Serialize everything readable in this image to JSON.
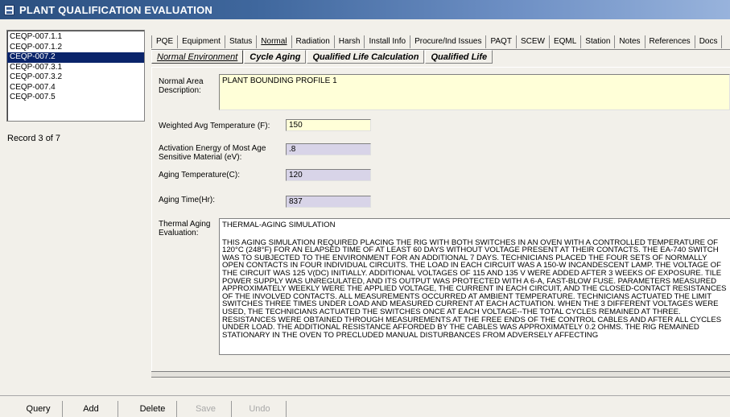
{
  "window": {
    "title": "PLANT QUALIFICATION EVALUATION"
  },
  "records": {
    "items": [
      "CEQP-007.1.1",
      "CEQP-007.1.2",
      "CEQP-007.2",
      "CEQP-007.3.1",
      "CEQP-007.3.2",
      "CEQP-007.4",
      "CEQP-007.5"
    ],
    "selected_index": 2,
    "count_text": "Record 3 of 7"
  },
  "tabs": {
    "items": [
      "PQE",
      "Equipment",
      "Status",
      "Normal",
      "Radiation",
      "Harsh",
      "Install Info",
      "Procure/Ind Issues",
      "PAQT",
      "SCEW",
      "EQML",
      "Station",
      "Notes",
      "References",
      "Docs"
    ],
    "active": "Normal"
  },
  "subtabs": {
    "items": [
      "Normal Environment",
      "Cycle Aging",
      "Qualified Life Calculation",
      "Qualified Life"
    ],
    "active": "Normal Environment"
  },
  "form": {
    "normal_area_label": "Normal Area Description:",
    "normal_area_value": "PLANT BOUNDING PROFILE 1",
    "weighted_avg_label": "Weighted Avg Temperature (F):",
    "weighted_avg_value": "150",
    "activation_energy_label": "Activation Energy of Most Age Sensitive Material (eV):",
    "activation_energy_value": ".8",
    "aging_temp_label": "Aging Temperature(C):",
    "aging_temp_value": "120",
    "aging_time_label": "Aging Time(Hr):",
    "aging_time_value": "837",
    "thermal_label": "Thermal Aging Evaluation:",
    "thermal_title": "THERMAL-AGING SIMULATION",
    "thermal_body": "THIS AGING SIMULATION REQUIRED PLACING THE RIG WITH BOTH SWITCHES IN AN OVEN WITH A CONTROLLED TEMPERATURE OF 120°C (248°F) FOR AN ELAPSED TIME OF AT LEAST 60 DAYS WITHOUT VOLTAGE PRESENT AT THEIR CONTACTS. THE EA-740 SWITCH WAS TO SUBJECTED TO THE ENVIRONMENT FOR AN ADDITIONAL 7 DAYS. TECHNICIANS PLACED THE FOUR SETS OF NORMALLY OPEN CONTACTS IN FOUR INDIVIDUAL CIRCUITS. THE LOAD IN EACH CIRCUIT WAS A 150-W INCANDESCENT LAMP. THE VOLTAGE OF THE CIRCUIT WAS 125 V(DC) INITIALLY. ADDITIONAL VOLTAGES OF 115 AND 135 V WERE ADDED AFTER 3 WEEKS OF EXPOSURE. TILE POWER SUPPLY WAS UNREGULATED, AND ITS OUTPUT WAS PROTECTED WITH A 6-A, FAST-BLOW FUSE. PARAMETERS MEASURED APPROXIMATELY WEEKLY WERE THE APPLIED VOLTAGE, THE CURRENT IN EACH CIRCUIT, AND THE CLOSED-CONTACT RESISTANCES OF THE INVOLVED CONTACTS. ALL MEASUREMENTS OCCURRED AT AMBIENT TEMPERATURE. TECHNICIANS ACTUATED THE LIMIT SWITCHES THREE TIMES UNDER LOAD AND MEASURED CURRENT AT EACH ACTUATION. WHEN THE 3 DIFFERENT VOLTAGES WERE USED, THE TECHNICIANS ACTUATED THE SWITCHES ONCE AT EACH VOLTAGE--THE TOTAL CYCLES REMAINED AT THREE. RESISTANCES WERE OBTAINED THROUGH MEASUREMENTS AT THE FREE ENDS OF THE CONTROL CABLES AND AFTER ALL CYCLES UNDER LOAD. THE ADDITIONAL RESISTANCE AFFORDED BY THE CABLES WAS APPROXIMATELY 0.2 OHMS. THE RIG REMAINED STATIONARY IN THE OVEN TO PRECLUDED MANUAL DISTURBANCES FROM ADVERSELY AFFECTING"
  },
  "buttons": {
    "query": "Query",
    "add": "Add",
    "delete": "Delete",
    "save": "Save",
    "undo": "Undo"
  }
}
